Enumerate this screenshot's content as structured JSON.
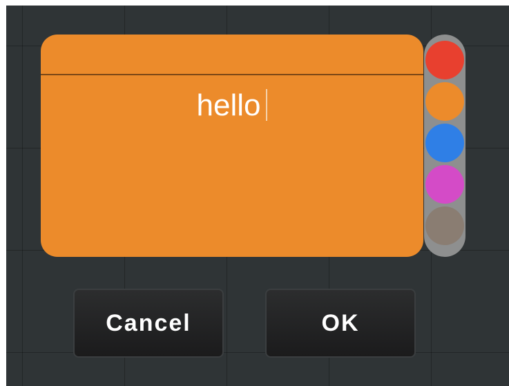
{
  "note": {
    "text": "hello",
    "color": "#ec8b2b"
  },
  "palette": {
    "swatches": [
      {
        "name": "red",
        "color": "#e8402f"
      },
      {
        "name": "orange",
        "color": "#ec8b2b"
      },
      {
        "name": "blue",
        "color": "#2f7fe6"
      },
      {
        "name": "magenta",
        "color": "#d44bc7"
      },
      {
        "name": "gray",
        "color": "#8a7d72"
      }
    ],
    "selected": "orange"
  },
  "buttons": {
    "cancel_label": "Cancel",
    "ok_label": "OK"
  }
}
